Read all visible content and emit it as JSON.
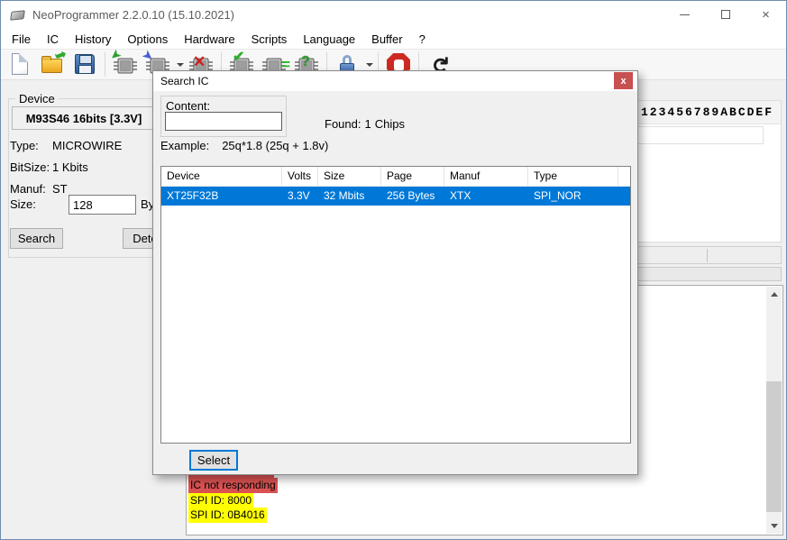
{
  "window": {
    "title": "NeoProgrammer 2.2.0.10 (15.10.2021)",
    "close_glyph": "×"
  },
  "menu": {
    "items": [
      "File",
      "IC",
      "History",
      "Options",
      "Hardware",
      "Scripts",
      "Language",
      "Buffer",
      "?"
    ]
  },
  "toolbar": {
    "icons": [
      "new-file",
      "open-file",
      "save-file",
      "read-ic",
      "write-ic",
      "erase-ic",
      "verify-ic",
      "compare-ic",
      "detect-ic",
      "lock-options",
      "stop-operation",
      "refresh"
    ]
  },
  "device_panel": {
    "group_label": "Device",
    "device_name": "M93S46 16bits [3.3V]",
    "fields": [
      {
        "label": "Type:",
        "value": "MICROWIRE"
      },
      {
        "label": "BitSize:",
        "value": "1 Kbits"
      },
      {
        "label": "Manuf:",
        "value": "ST"
      }
    ],
    "size_label": "Size:",
    "size_value": "128",
    "size_unit": "Bytes",
    "search_button": "Search",
    "detect_button": "Detect"
  },
  "hex_panel": {
    "header_text": "123456789ABCDEF"
  },
  "log": {
    "lines": [
      {
        "text": "",
        "bg": "#db5252"
      },
      {
        "text": "IC not responding",
        "bg": "#db5252"
      },
      {
        "text": "SPI ID: 8000",
        "bg": "#ffff00"
      },
      {
        "text": "SPI ID: 0B4016",
        "bg": "#ffff00"
      }
    ]
  },
  "dialog": {
    "title": "Search IC",
    "close_glyph": "x",
    "content_group": {
      "label": "Content:",
      "input_value": ""
    },
    "found_label": "Found:",
    "found_count": "1",
    "found_suffix": "Chips",
    "example_label": "Example:",
    "example_value": "25q*1.8 (25q + 1.8v)",
    "table": {
      "columns": [
        "Device",
        "Volts",
        "Size",
        "Page",
        "Manuf",
        "Type"
      ],
      "rows": [
        [
          "XT25F32B",
          "3.3V",
          "32 Mbits",
          "256 Bytes",
          "XTX",
          "SPI_NOR"
        ]
      ],
      "selected_index": 0
    },
    "select_button": "Select"
  },
  "colors": {
    "accent": "#0078d7",
    "selected_row_bg": "#0078d7",
    "log_error_bg": "#db5252",
    "log_info_bg": "#ffff00",
    "dialog_close_bg": "#c75050"
  }
}
